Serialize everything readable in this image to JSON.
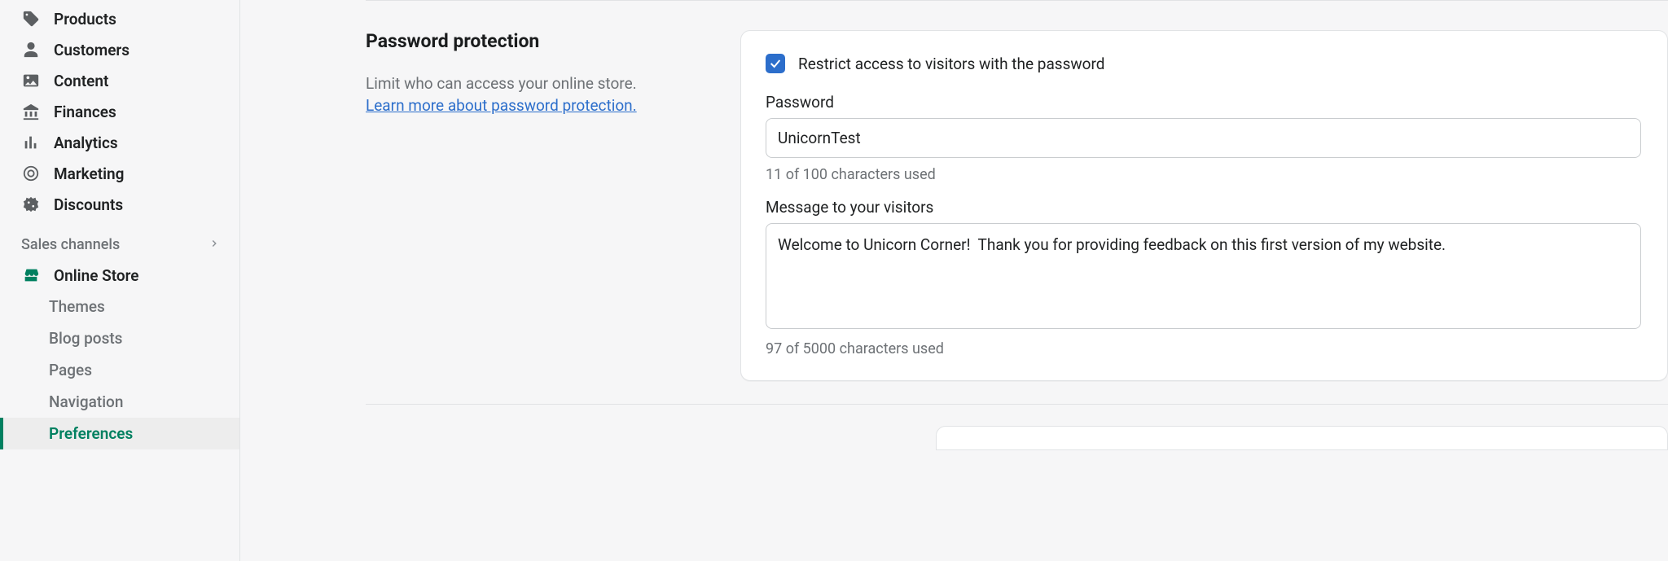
{
  "sidebar": {
    "items": [
      {
        "label": "Products"
      },
      {
        "label": "Customers"
      },
      {
        "label": "Content"
      },
      {
        "label": "Finances"
      },
      {
        "label": "Analytics"
      },
      {
        "label": "Marketing"
      },
      {
        "label": "Discounts"
      }
    ],
    "section_label": "Sales channels",
    "online_store": "Online Store",
    "sub_items": [
      {
        "label": "Themes"
      },
      {
        "label": "Blog posts"
      },
      {
        "label": "Pages"
      },
      {
        "label": "Navigation"
      },
      {
        "label": "Preferences"
      }
    ]
  },
  "section": {
    "title": "Password protection",
    "helper": "Limit who can access your online store.",
    "learn_more": "Learn more about password protection."
  },
  "card": {
    "restrict_label": "Restrict access to visitors with the password",
    "restrict_checked": true,
    "password_label": "Password",
    "password_value": "UnicornTest",
    "password_count": "11 of 100 characters used",
    "message_label": "Message to your visitors",
    "message_value": "Welcome to Unicorn Corner!  Thank you for providing feedback on this first version of my website.",
    "message_count": "97 of 5000 characters used"
  }
}
